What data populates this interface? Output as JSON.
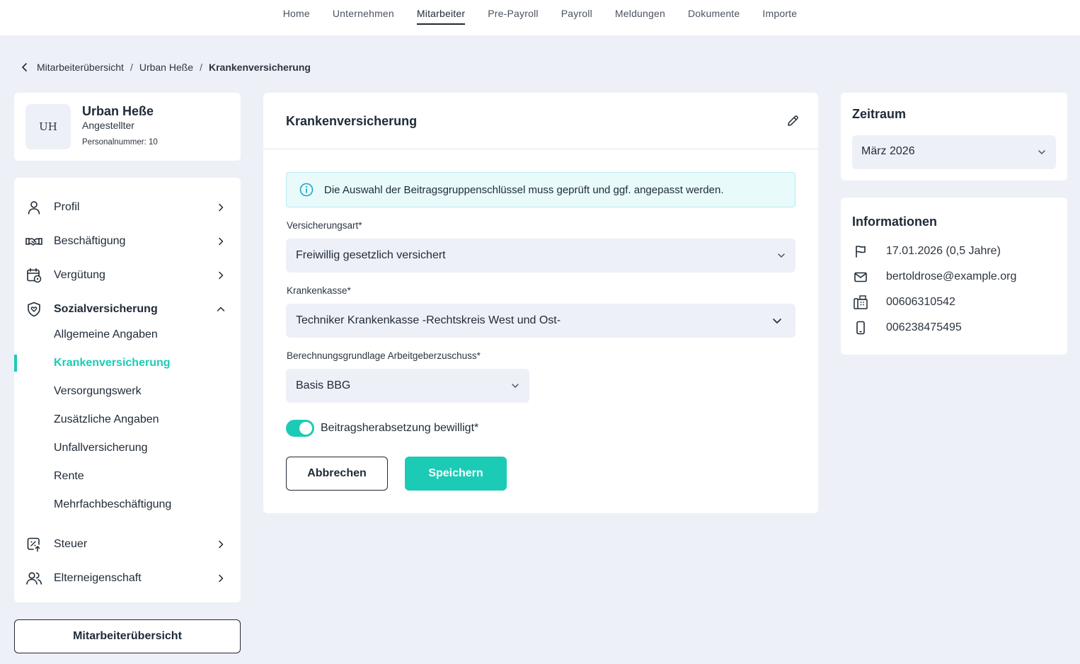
{
  "topnav": {
    "items": [
      {
        "label": "Home"
      },
      {
        "label": "Unternehmen"
      },
      {
        "label": "Mitarbeiter"
      },
      {
        "label": "Pre-Payroll"
      },
      {
        "label": "Payroll"
      },
      {
        "label": "Meldungen"
      },
      {
        "label": "Dokumente"
      },
      {
        "label": "Importe"
      }
    ],
    "active": "Mitarbeiter"
  },
  "breadcrumb": {
    "items": [
      "Mitarbeiterübersicht",
      "Urban Heße",
      "Krankenversicherung"
    ],
    "separator": "/"
  },
  "profile": {
    "initials": "UH",
    "name": "Urban Heße",
    "role": "Angestellter",
    "personnel_number": "Personalnummer:  10"
  },
  "sidebar": {
    "items": [
      {
        "label": "Profil",
        "icon": "user-icon"
      },
      {
        "label": "Beschäftigung",
        "icon": "handshake-icon"
      },
      {
        "label": "Vergütung",
        "icon": "calendar-money-icon"
      },
      {
        "label": "Sozialversicherung",
        "icon": "shield-heart-icon"
      },
      {
        "label": "Steuer",
        "icon": "tax-percent-icon"
      },
      {
        "label": "Elterneigenschaft",
        "icon": "users-icon"
      }
    ],
    "subitems": [
      {
        "label": "Allgemeine Angaben"
      },
      {
        "label": "Krankenversicherung"
      },
      {
        "label": "Versorgungswerk"
      },
      {
        "label": "Zusätzliche Angaben"
      },
      {
        "label": "Unfallversicherung"
      },
      {
        "label": "Rente"
      },
      {
        "label": "Mehrfachbeschäftigung"
      }
    ],
    "active_subitem": "Krankenversicherung",
    "overview_button": "Mitarbeiterübersicht"
  },
  "main": {
    "title": "Krankenversicherung",
    "info_message": "Die Auswahl der Beitragsgruppenschlüssel muss geprüft und ggf. angepasst werden.",
    "fields": {
      "versicherungsart": {
        "label": "Versicherungsart*",
        "value": "Freiwillig gesetzlich versichert"
      },
      "krankenkasse": {
        "label": "Krankenkasse*",
        "value": "Techniker Krankenkasse -Rechtskreis West und Ost-"
      },
      "berechnungsgrundlage": {
        "label": "Berechnungsgrundlage Arbeitgeberzuschuss*",
        "value": "Basis BBG"
      }
    },
    "toggle": {
      "label": "Beitragsherabsetzung bewilligt*",
      "on": true
    },
    "cancel_label": "Abbrechen",
    "save_label": "Speichern"
  },
  "zeitraum": {
    "title": "Zeitraum",
    "value": "März 2026"
  },
  "informationen": {
    "title": "Informationen",
    "rows": [
      {
        "icon": "flag-icon",
        "text": "17.01.2026 (0,5 Jahre)"
      },
      {
        "icon": "mail-icon",
        "text": "bertoldrose@example.org"
      },
      {
        "icon": "phone-icon",
        "text": "00606310542"
      },
      {
        "icon": "mobile-icon",
        "text": "006238475495"
      }
    ]
  },
  "colors": {
    "accent": "#1ccbb6",
    "text": "#1f2a37",
    "background": "#eef0f7",
    "info_bg": "#e9fafb"
  }
}
